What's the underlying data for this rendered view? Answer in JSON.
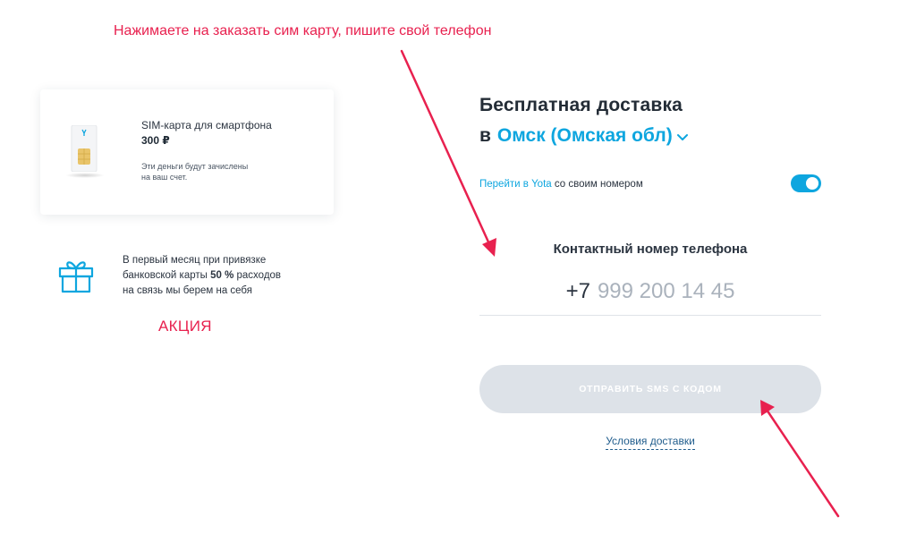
{
  "annotation": {
    "instruction_top": "Нажимаете на заказать сим карту, пишите свой телефон",
    "promo_label": "АКЦИЯ"
  },
  "sim_card": {
    "title": "SIM-карта для смартфона",
    "price": "300 ₽",
    "note_line1": "Эти деньги будут зачислены",
    "note_line2": "на ваш счет."
  },
  "promo": {
    "line1": "В первый месяц при привязке",
    "line2_before": "банковской карты ",
    "line2_bold": "50 %",
    "line2_after": " расходов",
    "line3": "на связь мы берем на себя",
    "icon": "gift-icon"
  },
  "delivery": {
    "title": "Бесплатная доставка",
    "in_word": "в",
    "city": "Омск (Омская обл)",
    "switch_link": "Перейти в Yota",
    "switch_text": " со своим номером",
    "toggle_on": true,
    "phone_label": "Контактный номер телефона",
    "phone_prefix": "+7",
    "phone_placeholder": "999 200 14 45",
    "sms_button": "ОТПРАВИТЬ SMS С КОДОМ",
    "terms_link": "Условия доставки"
  },
  "colors": {
    "accent": "#0ea6df",
    "annotation": "#e8214f",
    "button_disabled": "#dde2e8",
    "text": "#232c36"
  }
}
